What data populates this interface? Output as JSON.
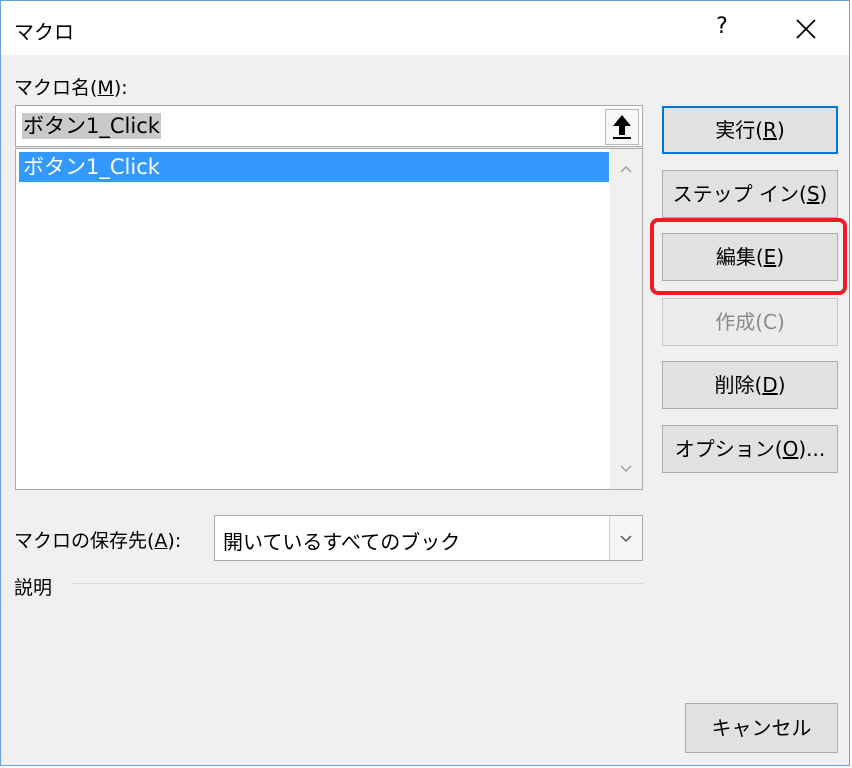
{
  "window": {
    "title": "マクロ",
    "help_glyph": "?"
  },
  "macro_name": {
    "label_pre": "マクロ名(",
    "label_key": "M",
    "label_post": "):",
    "value": "ボタン1_Click"
  },
  "macro_list": {
    "items": [
      "ボタン1_Click"
    ],
    "selected_index": 0
  },
  "buttons": {
    "run": {
      "pre": "実行(",
      "key": "R",
      "post": ")"
    },
    "step_in": {
      "pre": "ステップ イン(",
      "key": "S",
      "post": ")"
    },
    "edit": {
      "pre": "編集(",
      "key": "E",
      "post": ")"
    },
    "create": {
      "label": "作成(C)",
      "disabled": true
    },
    "delete": {
      "pre": "削除(",
      "key": "D",
      "post": ")"
    },
    "options": {
      "pre": "オプション(",
      "key": "O",
      "post": ")..."
    },
    "cancel": {
      "label": "キャンセル"
    }
  },
  "macro_location": {
    "label_pre": "マクロの保存先(",
    "label_key": "A",
    "label_post": "):",
    "selected": "開いているすべてのブック"
  },
  "description": {
    "label": "説明"
  },
  "colors": {
    "selection": "#3399ff",
    "highlight_box": "#ee1c25",
    "default_button_border": "#0078d7"
  }
}
